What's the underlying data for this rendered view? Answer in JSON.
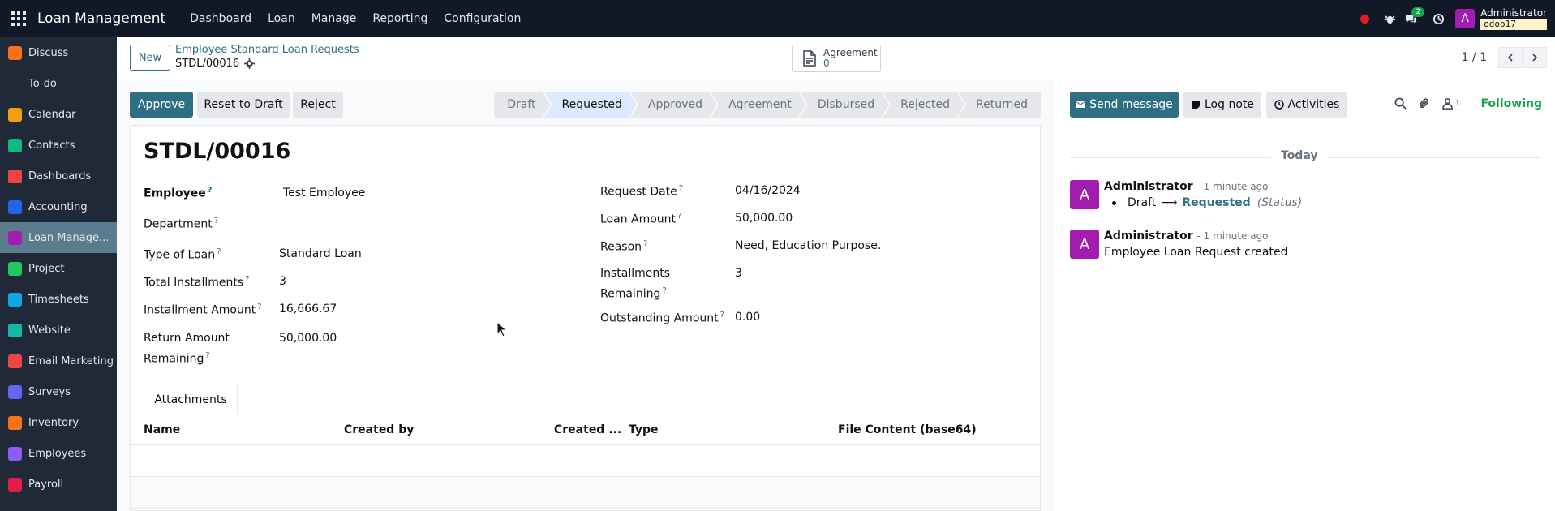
{
  "topbar": {
    "app_title": "Loan Management",
    "menu": [
      "Dashboard",
      "Loan",
      "Manage",
      "Reporting",
      "Configuration"
    ],
    "chat_badge": "2",
    "user_name": "Administrator",
    "db_name": "odoo17",
    "avatar_letter": "A"
  },
  "sidebar": {
    "items": [
      {
        "label": "Discuss",
        "icon": "discuss-icon",
        "color": "#f97316"
      },
      {
        "label": "To-do",
        "icon": "todo-icon",
        "color": "#1f2937"
      },
      {
        "label": "Calendar",
        "icon": "calendar-icon",
        "color": "#f59e0b"
      },
      {
        "label": "Contacts",
        "icon": "contacts-icon",
        "color": "#10b981"
      },
      {
        "label": "Dashboards",
        "icon": "dashboards-icon",
        "color": "#ef4444"
      },
      {
        "label": "Accounting",
        "icon": "accounting-icon",
        "color": "#2563eb"
      },
      {
        "label": "Loan Manage...",
        "icon": "loan-icon",
        "color": "#a21caf"
      },
      {
        "label": "Project",
        "icon": "project-icon",
        "color": "#22c55e"
      },
      {
        "label": "Timesheets",
        "icon": "timesheets-icon",
        "color": "#0ea5e9"
      },
      {
        "label": "Website",
        "icon": "website-icon",
        "color": "#14b8a6"
      },
      {
        "label": "Email Marketing",
        "icon": "email-marketing-icon",
        "color": "#ef4444"
      },
      {
        "label": "Surveys",
        "icon": "surveys-icon",
        "color": "#6366f1"
      },
      {
        "label": "Inventory",
        "icon": "inventory-icon",
        "color": "#f97316"
      },
      {
        "label": "Employees",
        "icon": "employees-icon",
        "color": "#8b5cf6"
      },
      {
        "label": "Payroll",
        "icon": "payroll-icon",
        "color": "#e11d48"
      }
    ]
  },
  "control": {
    "new_label": "New",
    "breadcrumb_parent": "Employee Standard Loan Requests",
    "breadcrumb_current": "STDL/00016",
    "smart_button_label": "Agreement",
    "smart_button_value": "0",
    "pager": "1 / 1"
  },
  "statusbar": {
    "approve": "Approve",
    "reset": "Reset to Draft",
    "reject": "Reject",
    "stages": [
      "Draft",
      "Requested",
      "Approved",
      "Agreement",
      "Disbursed",
      "Rejected",
      "Returned"
    ],
    "current_stage": "Requested"
  },
  "form": {
    "title": "STDL/00016",
    "left": [
      {
        "label": "Employee",
        "value": "Test Employee"
      },
      {
        "label": "Department",
        "value": ""
      },
      {
        "label": "Type of Loan",
        "value": "Standard Loan"
      },
      {
        "label": "Total Installments",
        "value": "3"
      },
      {
        "label": "Installment Amount",
        "value": "16,666.67"
      },
      {
        "label": "Return Amount",
        "label2": "Remaining",
        "value": "50,000.00"
      }
    ],
    "right": [
      {
        "label": "Request Date",
        "value": "04/16/2024"
      },
      {
        "label": "Loan Amount",
        "value": "50,000.00"
      },
      {
        "label": "Reason",
        "value": "Need, Education Purpose."
      },
      {
        "label": "Installments",
        "label2": "Remaining",
        "value": "3"
      },
      {
        "label": "Outstanding Amount",
        "value": "0.00"
      }
    ],
    "help_mark": "?",
    "tab_label": "Attachments",
    "table_headers": [
      "Name",
      "Created by",
      "Created ...",
      "Type",
      "File Content (base64)"
    ]
  },
  "chatter": {
    "send_message": "Send message",
    "log_note": "Log note",
    "activities": "Activities",
    "follower_count": "1",
    "following": "Following",
    "today": "Today",
    "messages": [
      {
        "author": "Administrator",
        "time": "- 1 minute ago",
        "old_value": "Draft",
        "arrow": "⟶",
        "new_value": "Requested",
        "field": "(Status)"
      },
      {
        "author": "Administrator",
        "time": "- 1 minute ago",
        "body": "Employee Loan Request created"
      }
    ],
    "avatar_letter": "A"
  }
}
